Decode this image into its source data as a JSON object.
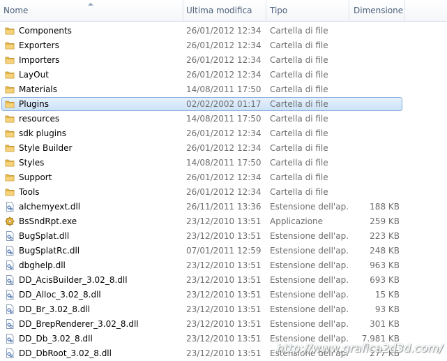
{
  "columns": {
    "name": "Nome",
    "modified": "Ultima modifica",
    "type": "Tipo",
    "size": "Dimensione"
  },
  "selected_index": 5,
  "files": [
    {
      "name": "Components",
      "modified": "26/01/2012 12:34",
      "type": "Cartella di file",
      "size": "",
      "icon": "folder-icon"
    },
    {
      "name": "Exporters",
      "modified": "26/01/2012 12:34",
      "type": "Cartella di file",
      "size": "",
      "icon": "folder-icon"
    },
    {
      "name": "Importers",
      "modified": "26/01/2012 12:34",
      "type": "Cartella di file",
      "size": "",
      "icon": "folder-icon"
    },
    {
      "name": "LayOut",
      "modified": "26/01/2012 12:34",
      "type": "Cartella di file",
      "size": "",
      "icon": "folder-icon"
    },
    {
      "name": "Materials",
      "modified": "14/08/2011 17:50",
      "type": "Cartella di file",
      "size": "",
      "icon": "folder-icon"
    },
    {
      "name": "Plugins",
      "modified": "02/02/2002 01:17",
      "type": "Cartella di file",
      "size": "",
      "icon": "folder-icon"
    },
    {
      "name": "resources",
      "modified": "14/08/2011 17:50",
      "type": "Cartella di file",
      "size": "",
      "icon": "folder-icon"
    },
    {
      "name": "sdk plugins",
      "modified": "26/01/2012 12:34",
      "type": "Cartella di file",
      "size": "",
      "icon": "folder-icon"
    },
    {
      "name": "Style Builder",
      "modified": "26/01/2012 12:34",
      "type": "Cartella di file",
      "size": "",
      "icon": "folder-icon"
    },
    {
      "name": "Styles",
      "modified": "14/08/2011 17:50",
      "type": "Cartella di file",
      "size": "",
      "icon": "folder-icon"
    },
    {
      "name": "Support",
      "modified": "26/01/2012 12:34",
      "type": "Cartella di file",
      "size": "",
      "icon": "folder-icon"
    },
    {
      "name": "Tools",
      "modified": "26/01/2012 12:34",
      "type": "Cartella di file",
      "size": "",
      "icon": "folder-icon"
    },
    {
      "name": "alchemyext.dll",
      "modified": "26/11/2011 13:36",
      "type": "Estensione dell'ap...",
      "size": "188 KB",
      "icon": "dll-file-icon"
    },
    {
      "name": "BsSndRpt.exe",
      "modified": "23/12/2010 13:51",
      "type": "Applicazione",
      "size": "259 KB",
      "icon": "exe-gear-icon"
    },
    {
      "name": "BugSplat.dll",
      "modified": "23/12/2010 13:51",
      "type": "Estensione dell'ap...",
      "size": "223 KB",
      "icon": "dll-file-icon"
    },
    {
      "name": "BugSplatRc.dll",
      "modified": "07/01/2011 12:59",
      "type": "Estensione dell'ap...",
      "size": "248 KB",
      "icon": "dll-file-icon"
    },
    {
      "name": "dbghelp.dll",
      "modified": "23/12/2010 13:51",
      "type": "Estensione dell'ap...",
      "size": "963 KB",
      "icon": "dll-file-icon"
    },
    {
      "name": "DD_AcisBuilder_3.02_8.dll",
      "modified": "23/12/2010 13:51",
      "type": "Estensione dell'ap...",
      "size": "693 KB",
      "icon": "dll-file-icon"
    },
    {
      "name": "DD_Alloc_3.02_8.dll",
      "modified": "23/12/2010 13:51",
      "type": "Estensione dell'ap...",
      "size": "15 KB",
      "icon": "dll-file-icon"
    },
    {
      "name": "DD_Br_3.02_8.dll",
      "modified": "23/12/2010 13:51",
      "type": "Estensione dell'ap...",
      "size": "93 KB",
      "icon": "dll-file-icon"
    },
    {
      "name": "DD_BrepRenderer_3.02_8.dll",
      "modified": "23/12/2010 13:51",
      "type": "Estensione dell'ap...",
      "size": "301 KB",
      "icon": "dll-file-icon"
    },
    {
      "name": "DD_Db_3.02_8.dll",
      "modified": "23/12/2010 13:51",
      "type": "Estensione dell'ap...",
      "size": "7.981 KB",
      "icon": "dll-file-icon"
    },
    {
      "name": "DD_DbRoot_3.02_8.dll",
      "modified": "23/12/2010 13:51",
      "type": "Estensione dell'ap...",
      "size": "277 KB",
      "icon": "dll-file-icon"
    }
  ],
  "watermark": "http://www.grafica2d3d.com/",
  "colors": {
    "folder": "#e8b84a",
    "selection_border": "#84acdd",
    "selection_fill": "#d9e9fa",
    "header_text": "#4c607a",
    "detail_text": "#6d6d6d"
  }
}
